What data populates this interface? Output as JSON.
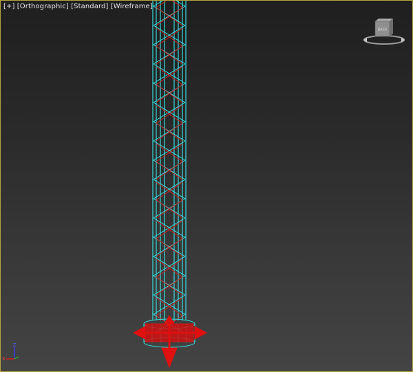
{
  "viewport": {
    "label_parts": [
      "[+]",
      "[Orthographic]",
      "[Standard]",
      "[Wireframe]"
    ],
    "view_cube_face": "BACK",
    "axis_label_z": "Z",
    "axis_label_x": "X",
    "colors": {
      "border_active": "#b7a43c",
      "wire_selected": "#33e0e0",
      "gizmo": "#e01010",
      "background_top": "#1f1f1f",
      "background_bottom": "#444444"
    },
    "icons": [
      "view-cube-icon",
      "axis-tripod-icon",
      "move-gizmo-icon"
    ]
  }
}
